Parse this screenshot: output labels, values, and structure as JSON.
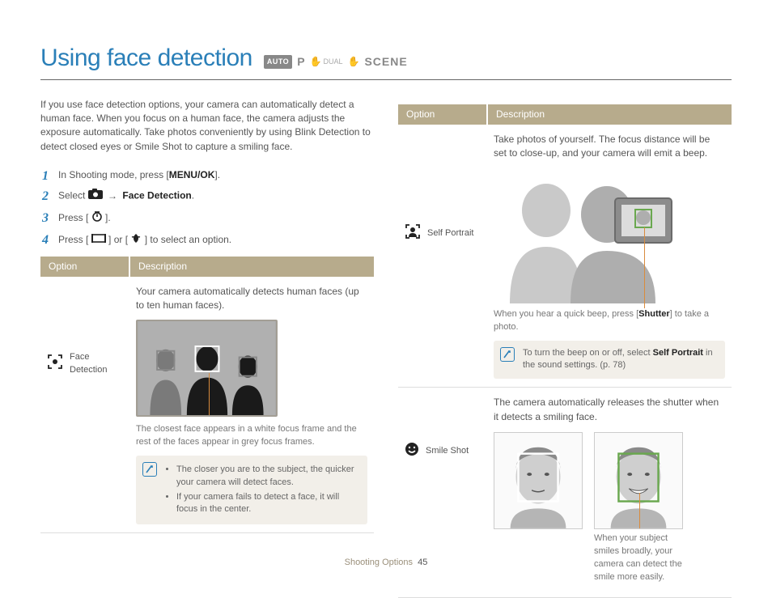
{
  "title": "Using face detection",
  "modes": {
    "auto": "AUTO",
    "p": "P",
    "dual": "DUAL",
    "scene": "SCENE"
  },
  "intro": "If you use face detection options, your camera can automatically detect a human face. When you focus on a human face, the camera adjusts the exposure automatically. Take photos conveniently by using Blink Detection to detect closed eyes or Smile Shot to capture a smiling face.",
  "steps": {
    "s1a": "In Shooting mode, press [",
    "s1b": "MENU/OK",
    "s1c": "].",
    "s2a": "Select ",
    "s2b": "Face Detection",
    "s2c": ".",
    "s3a": "Press [",
    "s3b": "].",
    "s4a": "Press [",
    "s4b": "] or [",
    "s4c": "] to select an option."
  },
  "table": {
    "hOption": "Option",
    "hDesc": "Description"
  },
  "left": {
    "fdLabel": "Face Detection",
    "fdDesc": "Your camera automatically detects human faces (up to ten human faces).",
    "fdCaption": "The closest face appears in a white focus frame and the rest of the faces appear in grey focus frames.",
    "note1": "The closer you are to the subject, the quicker your camera will detect faces.",
    "note2": "If your camera fails to detect a face, it will focus in the center."
  },
  "right": {
    "spLabel": "Self Portrait",
    "spDesc": "Take photos of yourself. The focus distance will be set to close-up, and your camera will emit a beep.",
    "spCap1": "When you hear a quick beep, press [",
    "spCap1b": "Shutter",
    "spCap1c": "] to take a photo.",
    "spNote1": "To turn the beep on or off, select ",
    "spNote2": "Self Portrait",
    "spNote3": " in the sound settings. (p. 78)",
    "smLabel": "Smile Shot",
    "smDesc": "The camera automatically releases the shutter when it detects a smiling face.",
    "smCap": "When your subject smiles broadly, your camera can detect the smile more easily."
  },
  "footer": {
    "section": "Shooting Options",
    "page": "45"
  }
}
